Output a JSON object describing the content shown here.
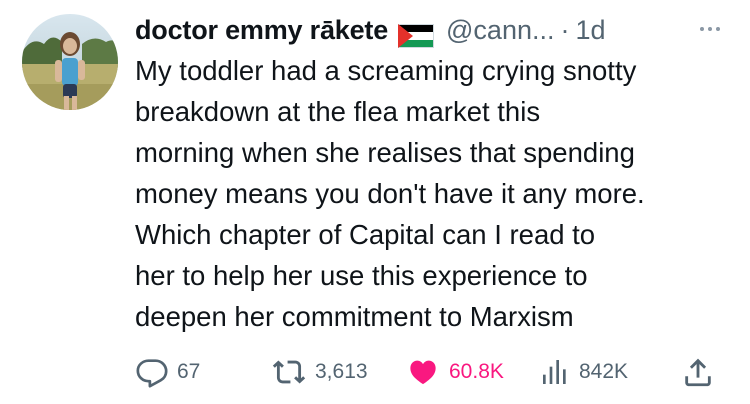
{
  "author": {
    "display_name": "doctor emmy rākete",
    "handle": "@cann...",
    "separator": "·",
    "time": "1d",
    "flag_icon": "palestine-flag-icon"
  },
  "tweet": {
    "lines": [
      "My toddler had a screaming crying snotty",
      "breakdown at the flea market this",
      "morning when she realises that spending",
      "money means you don't have it any more.",
      "Which chapter of Capital can I read to",
      "her to help her use this experience to",
      "deepen her commitment to Marxism"
    ]
  },
  "actions": {
    "replies": "67",
    "retweets": "3,613",
    "likes": "60.8K",
    "views": "842K"
  },
  "colors": {
    "text": "#0f1419",
    "secondary": "#536471",
    "like": "#f91880",
    "flag_red": "#e4312b",
    "flag_green": "#149954"
  }
}
